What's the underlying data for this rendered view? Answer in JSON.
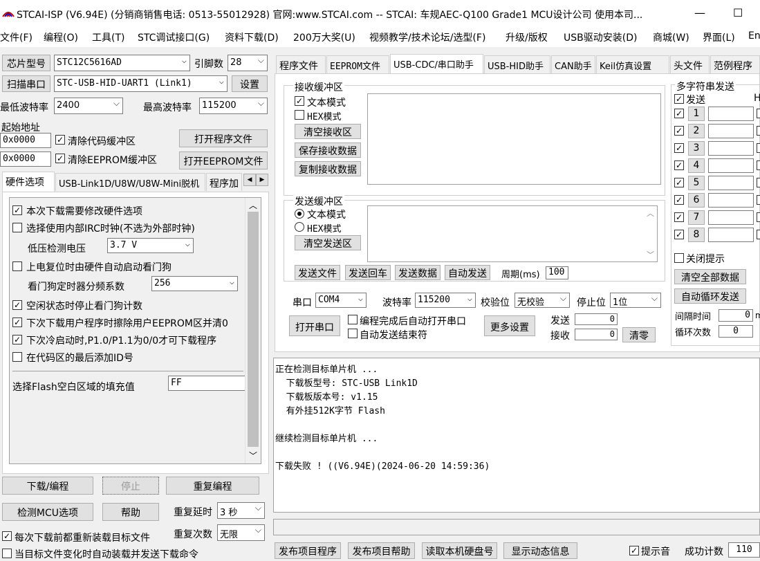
{
  "title": {
    "text": "STCAI-ISP (V6.94E) (分销商销售电话: 0513-55012928) 官网:www.STCAI.com  -- STCAI: 车规AEC-Q100 Grade1 MCU设计公司 使用本司...",
    "min": "—",
    "max": "☐"
  },
  "menu": [
    "文件(F)",
    "编程(O)",
    "工具(T)",
    "STC调试接口(G)",
    "资料下载(D)",
    "200万大奖(U)",
    "视频教学/技术论坛/选型(F)",
    "升级/版权",
    "USB驱动安装(D)",
    "商城(W)",
    "界面(L)",
    "En"
  ],
  "left": {
    "chip_label": "芯片型号",
    "chip_value": "STC12C5616AD",
    "pins_label": "引脚数",
    "pins_value": "28",
    "scan_btn": "扫描串口",
    "port_value": "STC-USB-HID-UART1 (Link1)",
    "settings_btn": "设置",
    "minbaud_label": "最低波特率",
    "minbaud_value": "2400",
    "maxbaud_label": "最高波特率",
    "maxbaud_value": "115200",
    "start_addr_label": "起始地址",
    "addr1": "0x0000",
    "clear_code": "清除代码缓冲区",
    "open_prog": "打开程序文件",
    "addr2": "0x0000",
    "clear_eeprom": "清除EEPROM缓冲区",
    "open_eeprom": "打开EEPROM文件",
    "tabs": [
      "硬件选项",
      "USB-Link1D/U8W/U8W-Mini脱机",
      "程序加"
    ],
    "options": [
      {
        "checked": true,
        "text": "本次下载需要修改硬件选项"
      },
      {
        "checked": false,
        "text": "选择使用内部IRC时钟(不选为外部时钟)"
      }
    ],
    "lvd_label": "低压检测电压",
    "lvd_value": "3.7 V",
    "wdt_opt": "上电复位时由硬件自动启动看门狗",
    "wdt_label": "看门狗定时器分频系数",
    "wdt_value": "256",
    "options2": [
      {
        "checked": true,
        "text": "空闲状态时停止看门狗计数"
      },
      {
        "checked": true,
        "text": "下次下载用户程序时擦除用户EEPROM区并清0"
      },
      {
        "checked": true,
        "text": "下次冷启动时,P1.0/P1.1为0/0才可下载程序"
      },
      {
        "checked": false,
        "text": "在代码区的最后添加ID号"
      }
    ],
    "fill_label": "选择Flash空白区域的填充值",
    "fill_value": "FF",
    "download_btn": "下载/编程",
    "stop_btn": "停止",
    "reprog_btn": "重复编程",
    "check_btn": "检测MCU选项",
    "help_btn": "帮助",
    "delay_label": "重复延时",
    "delay_value": "3 秒",
    "reload_opt": "每次下载前都重新装载目标文件",
    "count_label": "重复次数",
    "count_value": "无限",
    "auto_opt": "当目标文件变化时自动装载并发送下载命令"
  },
  "right_tabs": [
    "程序文件",
    "EEPROM文件",
    "USB-CDC/串口助手",
    "USB-HID助手",
    "CAN助手",
    "Keil仿真设置",
    "头文件",
    "范例程序"
  ],
  "serial": {
    "recv_title": "接收缓冲区",
    "recv_text_mode": "文本模式",
    "recv_hex_mode": "HEX模式",
    "clear_recv": "清空接收区",
    "save_recv": "保存接收数据",
    "copy_recv": "复制接收数据",
    "send_title": "发送缓冲区",
    "send_text_mode": "文本模式",
    "send_hex_mode": "HEX模式",
    "clear_send": "清空发送区",
    "send_file": "发送文件",
    "send_cr": "发送回车",
    "send_data": "发送数据",
    "auto_send": "自动发送",
    "period_label": "周期(ms)",
    "period_value": "100",
    "port_label": "串口",
    "port_value": "COM4",
    "baud_label": "波特率",
    "baud_value": "115200",
    "parity_label": "校验位",
    "parity_value": "无校验",
    "stop_label": "停止位",
    "stop_value": "1位",
    "open_port": "打开串口",
    "auto_open": "编程完成后自动打开串口",
    "auto_end": "自动发送结束符",
    "more_settings": "更多设置",
    "tx_label": "发送",
    "tx_value": "0",
    "rx_label": "接收",
    "rx_value": "0",
    "clear_count": "清零"
  },
  "multi": {
    "title": "多字符串发送",
    "send_label": "发送",
    "hex_label": "H",
    "rows": [
      "1",
      "2",
      "3",
      "4",
      "5",
      "6",
      "7",
      "8"
    ],
    "close_tip": "关闭提示",
    "clear_all": "清空全部数据",
    "auto_loop": "自动循环发送",
    "interval_label": "间隔时间",
    "interval_value": "0",
    "interval_unit": "m",
    "loop_label": "循环次数",
    "loop_value": "0"
  },
  "log": [
    "正在检测目标单片机 ...",
    "  下载板型号: STC-USB Link1D",
    "  下载板版本号: v1.15",
    "  有外挂512K字节 Flash",
    "",
    "继续检测目标单片机 ...",
    "",
    "下载失败 ! ((V6.94E)(2024-06-20 14:59:36)"
  ],
  "bottom": {
    "publish_prog": "发布项目程序",
    "publish_help": "发布项目帮助",
    "read_disk": "读取本机硬盘号",
    "show_info": "显示动态信息",
    "sound": "提示音",
    "success_label": "成功计数",
    "success_value": "110"
  }
}
